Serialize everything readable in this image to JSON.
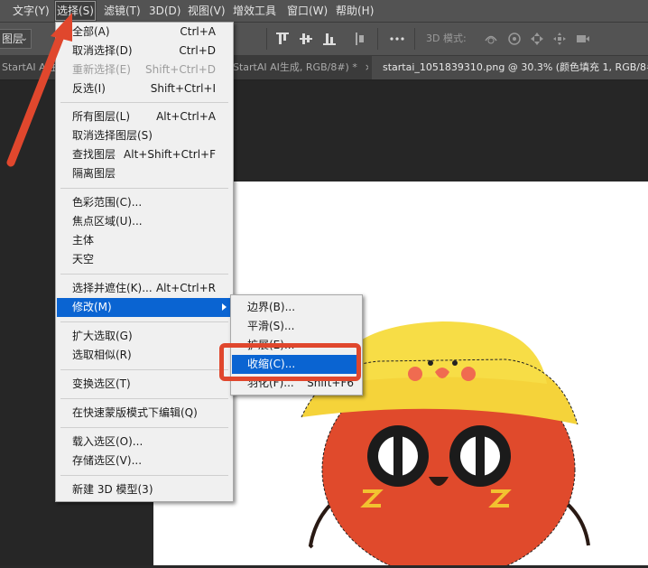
{
  "menubar": {
    "items": [
      "文字(Y)",
      "选择(S)",
      "滤镜(T)",
      "3D(D)",
      "视图(V)",
      "增效工具",
      "窗口(W)",
      "帮助(H)"
    ],
    "active_index": 1
  },
  "options_bar": {
    "layer_select": "图层",
    "mode3d_label": "3D 模式:"
  },
  "tabs": [
    {
      "label": "StartAI AI生成,"
    },
    {
      "label": "StartAI AI生成, RGB/8#) *",
      "close": "×"
    },
    {
      "label": "startai_1051839310.png @ 30.3% (颜色填充 1, RGB/8#) *"
    }
  ],
  "select_menu": {
    "items": [
      {
        "label": "全部(A)",
        "shortcut": "Ctrl+A"
      },
      {
        "label": "取消选择(D)",
        "shortcut": "Ctrl+D"
      },
      {
        "label": "重新选择(E)",
        "shortcut": "Shift+Ctrl+D",
        "disabled": true
      },
      {
        "label": "反选(I)",
        "shortcut": "Shift+Ctrl+I"
      },
      {
        "label": "所有图层(L)",
        "shortcut": "Alt+Ctrl+A"
      },
      {
        "label": "取消选择图层(S)",
        "shortcut": ""
      },
      {
        "label": "查找图层",
        "shortcut": "Alt+Shift+Ctrl+F"
      },
      {
        "label": "隔离图层",
        "shortcut": ""
      },
      {
        "label": "色彩范围(C)...",
        "shortcut": ""
      },
      {
        "label": "焦点区域(U)...",
        "shortcut": ""
      },
      {
        "label": "主体",
        "shortcut": ""
      },
      {
        "label": "天空",
        "shortcut": ""
      },
      {
        "label": "选择并遮住(K)...",
        "shortcut": "Alt+Ctrl+R"
      },
      {
        "label": "修改(M)",
        "shortcut": "",
        "submenu": true,
        "highlighted": true
      },
      {
        "label": "扩大选取(G)",
        "shortcut": ""
      },
      {
        "label": "选取相似(R)",
        "shortcut": ""
      },
      {
        "label": "变换选区(T)",
        "shortcut": ""
      },
      {
        "label": "在快速蒙版模式下编辑(Q)",
        "shortcut": ""
      },
      {
        "label": "载入选区(O)...",
        "shortcut": ""
      },
      {
        "label": "存储选区(V)...",
        "shortcut": ""
      },
      {
        "label": "新建 3D 模型(3)",
        "shortcut": ""
      }
    ]
  },
  "modify_submenu": {
    "items": [
      {
        "label": "边界(B)..."
      },
      {
        "label": "平滑(S)..."
      },
      {
        "label": "扩展(E)..."
      },
      {
        "label": "收缩(C)...",
        "highlighted": true
      },
      {
        "label": "羽化(F)...",
        "shortcut": "Shift+F6"
      }
    ]
  },
  "colors": {
    "menu_highlight": "#0a64d2",
    "annotation_red": "#e0472d"
  }
}
